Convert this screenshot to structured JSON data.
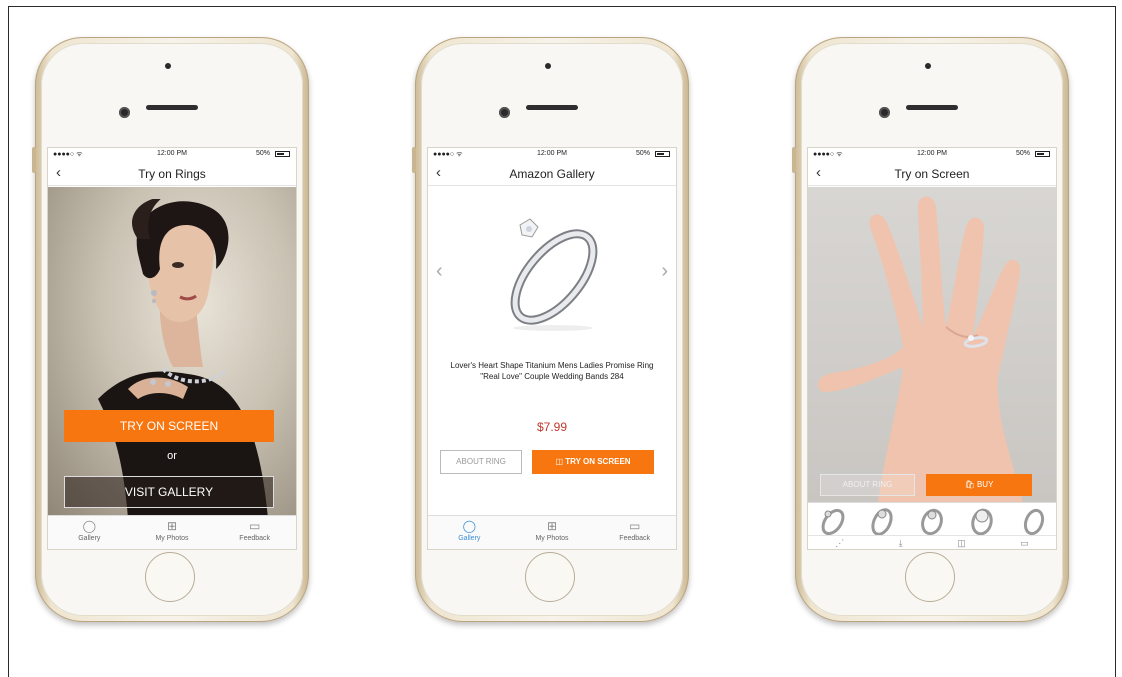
{
  "status_bar": {
    "signal": "●●●●○ ᯤ",
    "time": "12:00 PM",
    "battery": "50%"
  },
  "screens": [
    {
      "title": "Try on Rings",
      "back": "‹",
      "primary_button": "TRY ON SCREEN",
      "or_label": "or",
      "secondary_button": "VISIT GALLERY",
      "tabs": [
        {
          "label": "Gallery",
          "icon": "ring-icon"
        },
        {
          "label": "My Photos",
          "icon": "grid-icon"
        },
        {
          "label": "Feedback",
          "icon": "chat-icon"
        }
      ]
    },
    {
      "title": "Amazon Gallery",
      "back": "‹",
      "prev": "‹",
      "next": "›",
      "product_name": "Lover's Heart Shape Titanium Mens Ladies Promise Ring \"Real Love\" Couple Wedding Bands 284",
      "price": "$7.99",
      "about_button": "ABOUT RING",
      "try_button": "TRY ON SCREEN",
      "tabs": [
        {
          "label": "Gallery",
          "icon": "ring-icon"
        },
        {
          "label": "My Photos",
          "icon": "grid-icon"
        },
        {
          "label": "Feedback",
          "icon": "chat-icon"
        }
      ]
    },
    {
      "title": "Try on Screen",
      "back": "‹",
      "about_button": "ABOUT RING",
      "buy_button": "BUY",
      "tools": [
        "share-icon",
        "download-icon",
        "camera-icon",
        "chat-icon"
      ]
    }
  ],
  "colors": {
    "accent": "#f7760f",
    "price": "#c0392b",
    "active_tab": "#3b8fd9"
  }
}
